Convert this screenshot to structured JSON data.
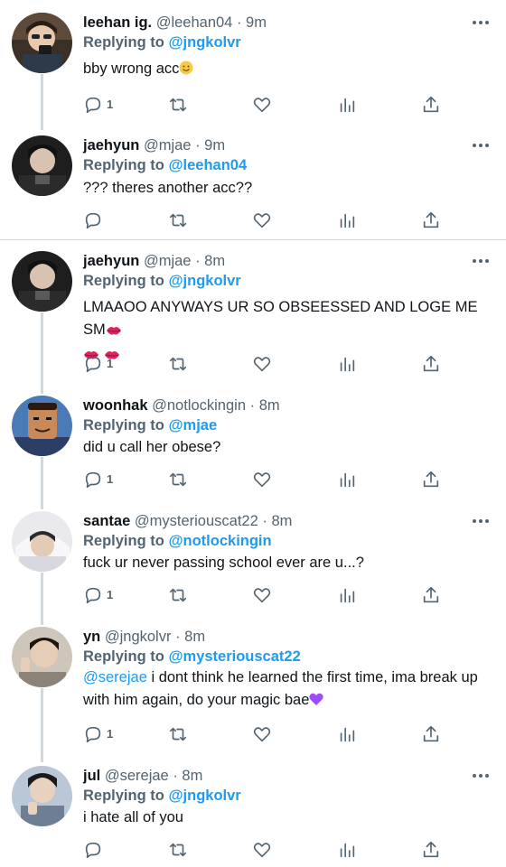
{
  "tweets": [
    {
      "name": "leehan ig.",
      "handle": "@leehan04",
      "time": "9m",
      "replying_prefix": "Replying to",
      "replying_to": "@jngkolvr",
      "text": "bby wrong acc",
      "reply_count": "1",
      "avatar_icon": "profile-photo"
    },
    {
      "name": "jaehyun",
      "handle": "@mjae",
      "time": "9m",
      "replying_prefix": "Replying to",
      "replying_to": "@leehan04",
      "text": "??? theres another acc??",
      "reply_count": "",
      "avatar_icon": "profile-photo"
    },
    {
      "name": "jaehyun",
      "handle": "@mjae",
      "time": "8m",
      "replying_prefix": "Replying to",
      "replying_to": "@jngkolvr",
      "text": "LMAAOO ANYWAYS UR SO OBSEESSED AND LOGE ME SM",
      "reply_count": "1",
      "avatar_icon": "profile-photo"
    },
    {
      "name": "woonhak",
      "handle": "@notlockingin",
      "time": "8m",
      "replying_prefix": "Replying to",
      "replying_to": "@mjae",
      "text": "did u call her obese?",
      "reply_count": "1",
      "avatar_icon": "profile-photo"
    },
    {
      "name": "santae",
      "handle": "@mysteriouscat22",
      "time": "8m",
      "replying_prefix": "Replying to",
      "replying_to": "@notlockingin",
      "text": "fuck ur never passing school ever are u...?",
      "reply_count": "1",
      "avatar_icon": "profile-photo"
    },
    {
      "name": "yn",
      "handle": "@jngkolvr",
      "time": "8m",
      "replying_prefix": "Replying to",
      "replying_to": "@mysteriouscat22",
      "text_mention": "@serejae",
      "text": " i dont think he learned the first time, ima break up with him again, do your magic bae",
      "reply_count": "1",
      "avatar_icon": "profile-photo"
    },
    {
      "name": "jul",
      "handle": "@serejae",
      "time": "8m",
      "replying_prefix": "Replying to",
      "replying_to": "@jngkolvr",
      "text": "i hate all of you",
      "reply_count": "",
      "avatar_icon": "profile-photo"
    }
  ],
  "separator": "·",
  "colors": {
    "accent": "#1d9bf0",
    "secondary_text": "#536471",
    "primary_text": "#0f1419",
    "divider": "#cfd9de",
    "heart_purple": "#9b4dff"
  },
  "action_icons": [
    "reply-icon",
    "retweet-icon",
    "like-icon",
    "views-icon",
    "share-icon"
  ]
}
